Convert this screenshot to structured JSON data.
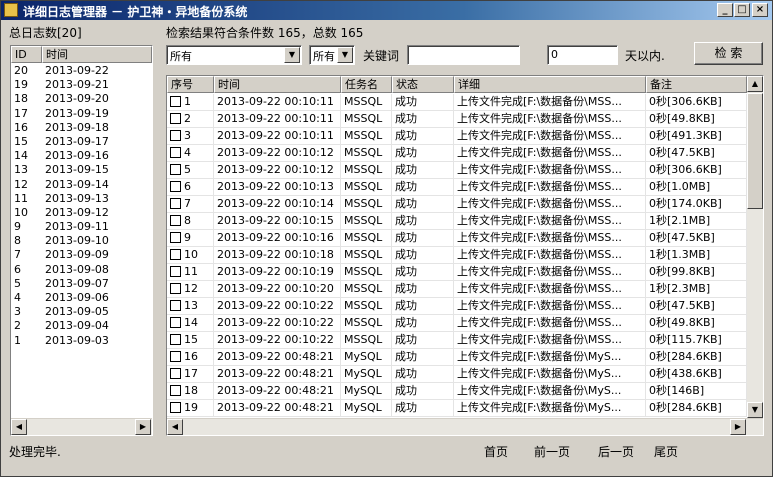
{
  "window": {
    "title": "详细日志管理器 － 护卫神・异地备份系统",
    "minimize": "_",
    "maximize": "□",
    "close": "×"
  },
  "left": {
    "total_label": "总日志数[20]",
    "headers": {
      "id": "ID",
      "time": "时间"
    },
    "rows": [
      {
        "id": "20",
        "date": "2013-09-22"
      },
      {
        "id": "19",
        "date": "2013-09-21"
      },
      {
        "id": "18",
        "date": "2013-09-20"
      },
      {
        "id": "17",
        "date": "2013-09-19"
      },
      {
        "id": "16",
        "date": "2013-09-18"
      },
      {
        "id": "15",
        "date": "2013-09-17"
      },
      {
        "id": "14",
        "date": "2013-09-16"
      },
      {
        "id": "13",
        "date": "2013-09-15"
      },
      {
        "id": "12",
        "date": "2013-09-14"
      },
      {
        "id": "11",
        "date": "2013-09-13"
      },
      {
        "id": "10",
        "date": "2013-09-12"
      },
      {
        "id": "9",
        "date": "2013-09-11"
      },
      {
        "id": "8",
        "date": "2013-09-10"
      },
      {
        "id": "7",
        "date": "2013-09-09"
      },
      {
        "id": "6",
        "date": "2013-09-08"
      },
      {
        "id": "5",
        "date": "2013-09-07"
      },
      {
        "id": "4",
        "date": "2013-09-06"
      },
      {
        "id": "3",
        "date": "2013-09-05"
      },
      {
        "id": "2",
        "date": "2013-09-04"
      },
      {
        "id": "1",
        "date": "2013-09-03"
      }
    ]
  },
  "search": {
    "result_text": "检索结果符合条件数 165，总数 165",
    "task_select": "所有",
    "status_select": "所有",
    "keyword_label": "关键词",
    "keyword_value": "",
    "days_value": "0",
    "days_suffix": "天以内.",
    "search_button": "检 索"
  },
  "grid": {
    "headers": {
      "seq": "序号",
      "time": "时间",
      "task": "任务名",
      "status": "状态",
      "detail": "详细",
      "note": "备注"
    },
    "rows": [
      {
        "seq": "1",
        "time": "2013-09-22 00:10:11",
        "task": "MSSQL",
        "status": "成功",
        "detail": "上传文件完成[F:\\数据备份\\MSS...",
        "note": "0秒[306.6KB]"
      },
      {
        "seq": "2",
        "time": "2013-09-22 00:10:11",
        "task": "MSSQL",
        "status": "成功",
        "detail": "上传文件完成[F:\\数据备份\\MSS...",
        "note": "0秒[49.8KB]"
      },
      {
        "seq": "3",
        "time": "2013-09-22 00:10:11",
        "task": "MSSQL",
        "status": "成功",
        "detail": "上传文件完成[F:\\数据备份\\MSS...",
        "note": "0秒[491.3KB]"
      },
      {
        "seq": "4",
        "time": "2013-09-22 00:10:12",
        "task": "MSSQL",
        "status": "成功",
        "detail": "上传文件完成[F:\\数据备份\\MSS...",
        "note": "0秒[47.5KB]"
      },
      {
        "seq": "5",
        "time": "2013-09-22 00:10:12",
        "task": "MSSQL",
        "status": "成功",
        "detail": "上传文件完成[F:\\数据备份\\MSS...",
        "note": "0秒[306.6KB]"
      },
      {
        "seq": "6",
        "time": "2013-09-22 00:10:13",
        "task": "MSSQL",
        "status": "成功",
        "detail": "上传文件完成[F:\\数据备份\\MSS...",
        "note": "0秒[1.0MB]"
      },
      {
        "seq": "7",
        "time": "2013-09-22 00:10:14",
        "task": "MSSQL",
        "status": "成功",
        "detail": "上传文件完成[F:\\数据备份\\MSS...",
        "note": "0秒[174.0KB]"
      },
      {
        "seq": "8",
        "time": "2013-09-22 00:10:15",
        "task": "MSSQL",
        "status": "成功",
        "detail": "上传文件完成[F:\\数据备份\\MSS...",
        "note": "1秒[2.1MB]"
      },
      {
        "seq": "9",
        "time": "2013-09-22 00:10:16",
        "task": "MSSQL",
        "status": "成功",
        "detail": "上传文件完成[F:\\数据备份\\MSS...",
        "note": "0秒[47.5KB]"
      },
      {
        "seq": "10",
        "time": "2013-09-22 00:10:18",
        "task": "MSSQL",
        "status": "成功",
        "detail": "上传文件完成[F:\\数据备份\\MSS...",
        "note": "1秒[1.3MB]"
      },
      {
        "seq": "11",
        "time": "2013-09-22 00:10:19",
        "task": "MSSQL",
        "status": "成功",
        "detail": "上传文件完成[F:\\数据备份\\MSS...",
        "note": "0秒[99.8KB]"
      },
      {
        "seq": "12",
        "time": "2013-09-22 00:10:20",
        "task": "MSSQL",
        "status": "成功",
        "detail": "上传文件完成[F:\\数据备份\\MSS...",
        "note": "1秒[2.3MB]"
      },
      {
        "seq": "13",
        "time": "2013-09-22 00:10:22",
        "task": "MSSQL",
        "status": "成功",
        "detail": "上传文件完成[F:\\数据备份\\MSS...",
        "note": "0秒[47.5KB]"
      },
      {
        "seq": "14",
        "time": "2013-09-22 00:10:22",
        "task": "MSSQL",
        "status": "成功",
        "detail": "上传文件完成[F:\\数据备份\\MSS...",
        "note": "0秒[49.8KB]"
      },
      {
        "seq": "15",
        "time": "2013-09-22 00:10:22",
        "task": "MSSQL",
        "status": "成功",
        "detail": "上传文件完成[F:\\数据备份\\MSS...",
        "note": "0秒[115.7KB]"
      },
      {
        "seq": "16",
        "time": "2013-09-22 00:48:21",
        "task": "MySQL",
        "status": "成功",
        "detail": "上传文件完成[F:\\数据备份\\MyS...",
        "note": "0秒[284.6KB]"
      },
      {
        "seq": "17",
        "time": "2013-09-22 00:48:21",
        "task": "MySQL",
        "status": "成功",
        "detail": "上传文件完成[F:\\数据备份\\MyS...",
        "note": "0秒[438.6KB]"
      },
      {
        "seq": "18",
        "time": "2013-09-22 00:48:21",
        "task": "MySQL",
        "status": "成功",
        "detail": "上传文件完成[F:\\数据备份\\MyS...",
        "note": "0秒[146B]"
      },
      {
        "seq": "19",
        "time": "2013-09-22 00:48:21",
        "task": "MySQL",
        "status": "成功",
        "detail": "上传文件完成[F:\\数据备份\\MyS...",
        "note": "0秒[284.6KB]"
      }
    ]
  },
  "footer": {
    "status": "处理完毕.",
    "first_page": "首页",
    "prev_page": "前一页",
    "next_page": "后一页",
    "last_page": "尾页"
  },
  "icons": {
    "app": "app-icon",
    "dropdown": "chevron-down-icon",
    "scroll_up": "arrow-up-icon",
    "scroll_down": "arrow-down-icon",
    "scroll_left": "arrow-left-icon",
    "scroll_right": "arrow-right-icon"
  },
  "colors": {
    "titlebar_start": "#0a246a",
    "titlebar_end": "#a6caf0",
    "window_bg": "#d4d0c8"
  }
}
